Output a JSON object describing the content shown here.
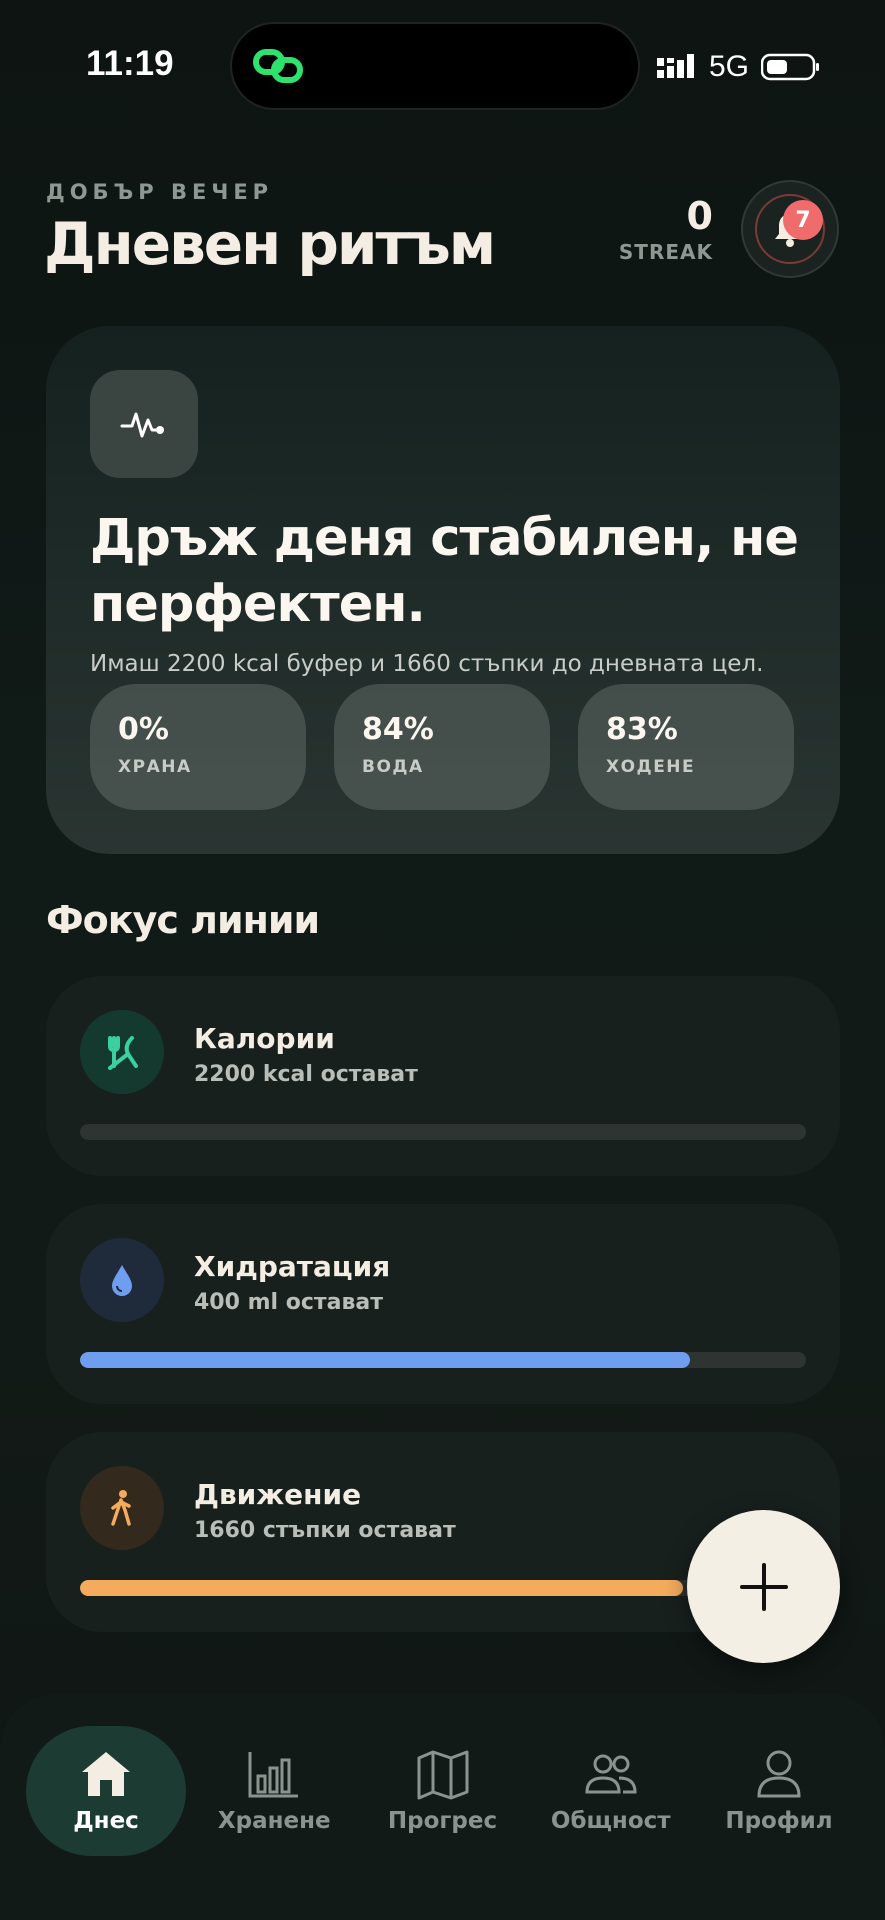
{
  "status_bar": {
    "time": "11:19",
    "network": "5G"
  },
  "header": {
    "greeting": "ДОБЪР ВЕЧЕР",
    "title": "Дневен ритъм",
    "streak_count": "0",
    "streak_label": "STREAK",
    "notification_count": "7"
  },
  "hero": {
    "icon": "heartbeat-icon",
    "title": "Дръж деня стабилен, не перфектен.",
    "subtitle": "Имаш 2200 kcal буфер и 1660 стъпки до дневната цел.",
    "stats": [
      {
        "value": "0%",
        "label": "ХРАНА"
      },
      {
        "value": "84%",
        "label": "ВОДА"
      },
      {
        "value": "83%",
        "label": "ХОДЕНЕ"
      }
    ]
  },
  "focus": {
    "section_title": "Фокус линии",
    "items": [
      {
        "title": "Калории",
        "subtitle": "2200 kcal остават",
        "icon": "fork-knife-icon",
        "progress": 0,
        "color": "#3ad0a0"
      },
      {
        "title": "Хидратация",
        "subtitle": "400 ml остават",
        "icon": "water-drop-icon",
        "progress": 84,
        "color": "#6f9ef0"
      },
      {
        "title": "Движение",
        "subtitle": "1660 стъпки остават",
        "icon": "walking-icon",
        "progress": 83,
        "color": "#f4ac5c"
      }
    ]
  },
  "fab": {
    "icon": "plus-icon"
  },
  "nav": {
    "items": [
      {
        "label": "Днес",
        "icon": "home-icon",
        "active": true
      },
      {
        "label": "Хранене",
        "icon": "bar-chart-icon",
        "active": false
      },
      {
        "label": "Прогрес",
        "icon": "map-icon",
        "active": false
      },
      {
        "label": "Общност",
        "icon": "people-icon",
        "active": false
      },
      {
        "label": "Профил",
        "icon": "user-icon",
        "active": false
      }
    ]
  },
  "colors": {
    "accent": "#1b3b33",
    "badge": "#f06b6b",
    "calories": "#3ad0a0",
    "hydration": "#6f9ef0",
    "movement": "#f4ac5c"
  }
}
